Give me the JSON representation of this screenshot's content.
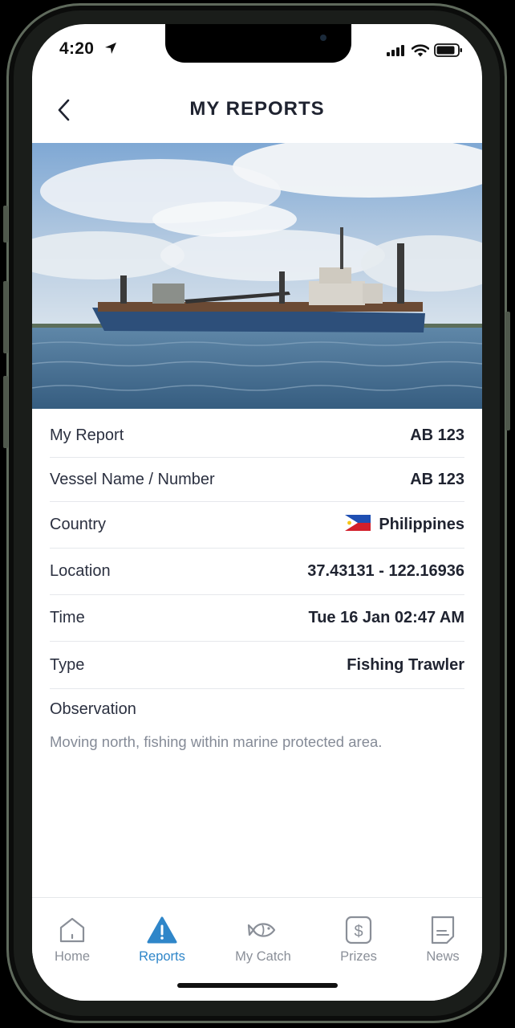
{
  "status": {
    "time": "4:20"
  },
  "header": {
    "title": "MY REPORTS"
  },
  "report": {
    "rows": [
      {
        "label": "My Report",
        "value": "AB 123"
      },
      {
        "label": "Vessel Name / Number",
        "value": "AB 123"
      },
      {
        "label": "Country",
        "value": "Philippines",
        "flag": "philippines-flag"
      },
      {
        "label": "Location",
        "value": "37.43131 - 122.16936"
      },
      {
        "label": "Time",
        "value": "Tue 16 Jan 02:47 AM"
      },
      {
        "label": "Type",
        "value": "Fishing Trawler"
      }
    ],
    "observation_label": "Observation",
    "observation_text": "Moving north, fishing within marine protected area."
  },
  "tabs": [
    {
      "label": "Home",
      "icon": "home-icon",
      "active": false
    },
    {
      "label": "Reports",
      "icon": "alert-icon",
      "active": true
    },
    {
      "label": "My Catch",
      "icon": "fish-icon",
      "active": false
    },
    {
      "label": "Prizes",
      "icon": "dollar-icon",
      "active": false
    },
    {
      "label": "News",
      "icon": "news-icon",
      "active": false
    }
  ],
  "colors": {
    "accent": "#2f86c9",
    "inactive": "#8a8f98",
    "text": "#1f2330"
  }
}
